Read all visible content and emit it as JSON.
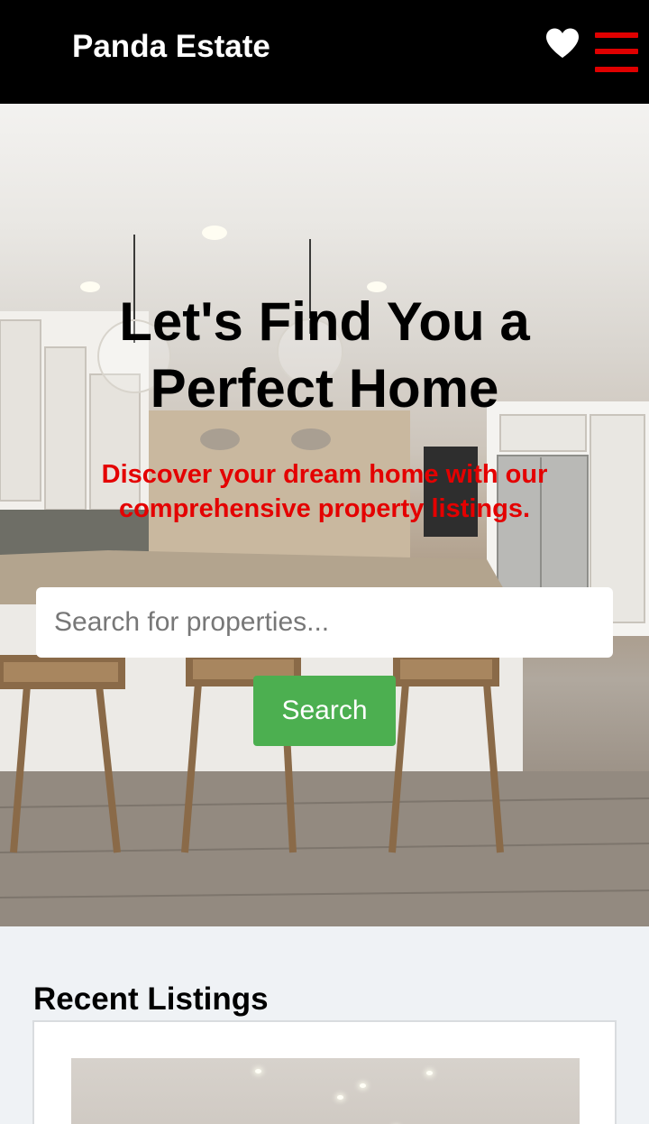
{
  "header": {
    "brand": "Panda Estate",
    "favorites_icon": "heart-icon",
    "menu_icon": "hamburger-menu-icon",
    "colors": {
      "background": "#000000",
      "menu_accent": "#e00000"
    }
  },
  "hero": {
    "title": "Let's Find You a Perfect Home",
    "subtitle": "Discover your dream home with our comprehensive property listings.",
    "search": {
      "placeholder": "Search for properties...",
      "value": ""
    },
    "search_button": "Search",
    "colors": {
      "subtitle": "#e40000",
      "button": "#4caf50"
    }
  },
  "recent": {
    "title": "Recent Listings"
  }
}
